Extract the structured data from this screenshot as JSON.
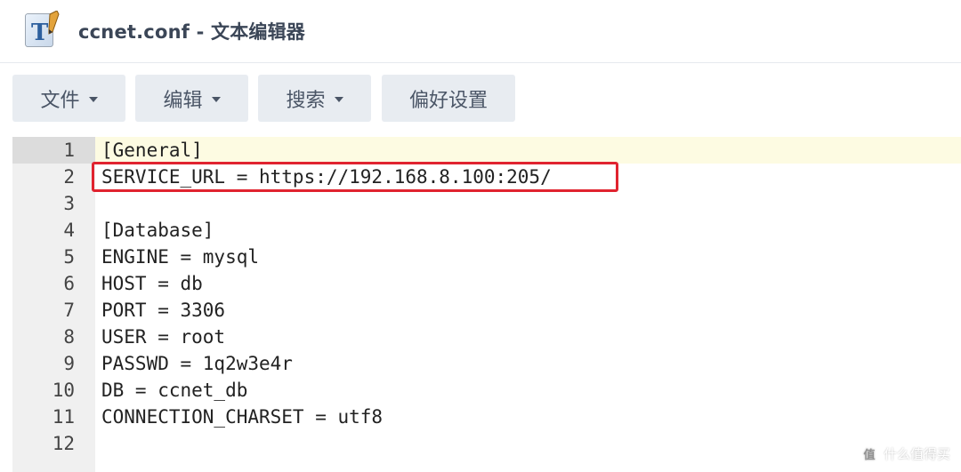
{
  "window": {
    "title": "ccnet.conf - 文本编辑器",
    "icon": "text-editor-icon"
  },
  "toolbar": {
    "buttons": [
      {
        "label": "文件",
        "has_dropdown": true
      },
      {
        "label": "编辑",
        "has_dropdown": true
      },
      {
        "label": "搜索",
        "has_dropdown": true
      },
      {
        "label": "偏好设置",
        "has_dropdown": false
      }
    ]
  },
  "editor": {
    "active_line": 1,
    "highlighted_line": 2,
    "highlight_color": "#e0232f",
    "lines": [
      {
        "num": "1",
        "text": "[General]"
      },
      {
        "num": "2",
        "text": "SERVICE_URL = https://192.168.8.100:205/"
      },
      {
        "num": "3",
        "text": ""
      },
      {
        "num": "4",
        "text": "[Database]"
      },
      {
        "num": "5",
        "text": "ENGINE = mysql"
      },
      {
        "num": "6",
        "text": "HOST = db"
      },
      {
        "num": "7",
        "text": "PORT = 3306"
      },
      {
        "num": "8",
        "text": "USER = root"
      },
      {
        "num": "9",
        "text": "PASSWD = 1q2w3e4r"
      },
      {
        "num": "10",
        "text": "DB = ccnet_db"
      },
      {
        "num": "11",
        "text": "CONNECTION_CHARSET = utf8"
      },
      {
        "num": "12",
        "text": ""
      }
    ]
  },
  "watermark": {
    "badge": "值",
    "text": "什么值得买"
  }
}
